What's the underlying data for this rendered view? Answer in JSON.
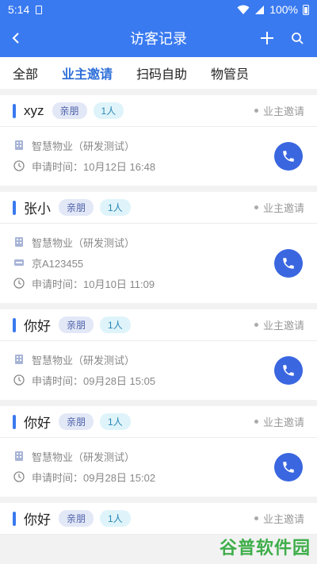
{
  "status_bar": {
    "time": "5:14",
    "battery": "100%"
  },
  "header": {
    "title": "访客记录",
    "accent": "#3a7af0"
  },
  "tabs": [
    {
      "label": "全部"
    },
    {
      "label": "业主邀请"
    },
    {
      "label": "扫码自助"
    },
    {
      "label": "物管员"
    }
  ],
  "records": [
    {
      "name": "xyz",
      "relation": "亲朋",
      "count": "1人",
      "type": "业主邀请",
      "property": "智慧物业（研发测试）",
      "plate": "",
      "apply_time": "申请时间：10月12日 16:48"
    },
    {
      "name": "张小",
      "relation": "亲朋",
      "count": "1人",
      "type": "业主邀请",
      "property": "智慧物业（研发测试）",
      "plate": "京A123455",
      "apply_time": "申请时间：10月10日 11:09"
    },
    {
      "name": "你好",
      "relation": "亲朋",
      "count": "1人",
      "type": "业主邀请",
      "property": "智慧物业（研发测试）",
      "plate": "",
      "apply_time": "申请时间：09月28日 15:05"
    },
    {
      "name": "你好",
      "relation": "亲朋",
      "count": "1人",
      "type": "业主邀请",
      "property": "智慧物业（研发测试）",
      "plate": "",
      "apply_time": "申请时间：09月28日 15:02"
    },
    {
      "name": "你好",
      "relation": "亲朋",
      "count": "1人",
      "type": "业主邀请",
      "property": "",
      "plate": "",
      "apply_time": ""
    }
  ],
  "watermark": "谷普软件园"
}
